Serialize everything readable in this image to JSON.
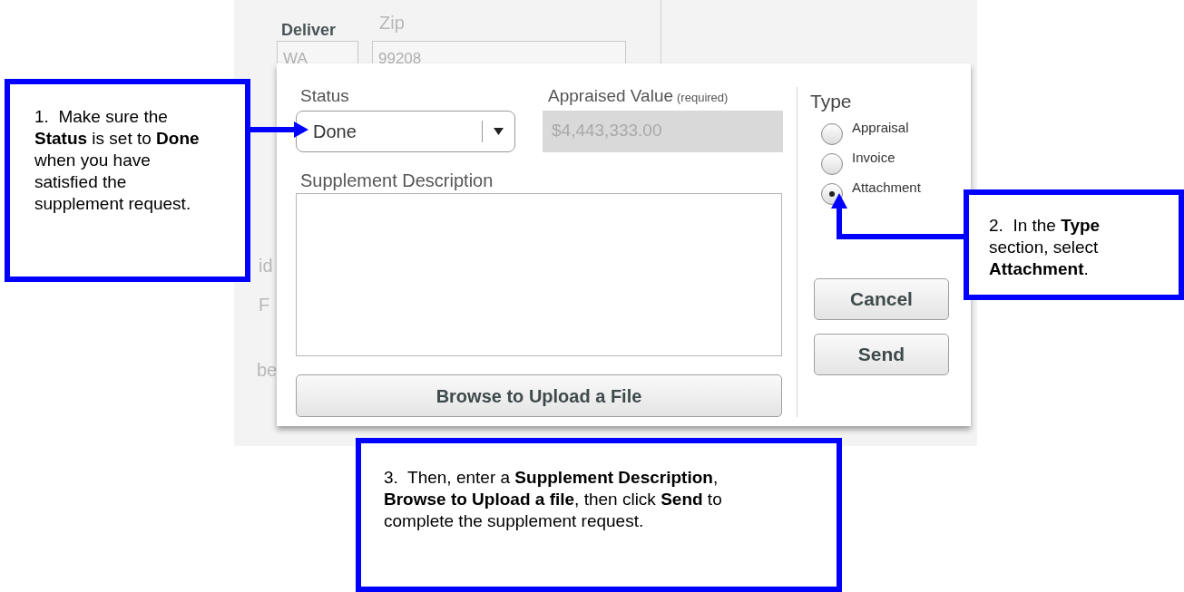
{
  "background": {
    "labels": [
      {
        "kind": "heading",
        "text": "Deliver"
      },
      {
        "kind": "faint",
        "text": "Zip"
      },
      {
        "kind": "field",
        "text": "WA"
      },
      {
        "kind": "field",
        "text": "99208"
      },
      {
        "kind": "faint",
        "text": "id"
      },
      {
        "kind": "faint",
        "text": "F"
      },
      {
        "kind": "faint",
        "text": "be"
      }
    ]
  },
  "dialog": {
    "status": {
      "label": "Status",
      "value": "Done"
    },
    "appraised_value": {
      "label": "Appraised Value",
      "note": "(required)",
      "value": "$4,443,333.00",
      "disabled": true
    },
    "description": {
      "label": "Supplement Description"
    },
    "browse_button": "Browse to Upload a File",
    "type": {
      "label": "Type",
      "options": [
        {
          "label": "Appraisal",
          "selected": false
        },
        {
          "label": "Invoice",
          "selected": false
        },
        {
          "label": "Attachment",
          "selected": true
        }
      ]
    },
    "buttons": [
      "Cancel",
      "Send"
    ]
  },
  "callouts": [
    {
      "text": "1.  Make sure the **Status** is set to **Done** when you have satisfied the supplement request."
    },
    {
      "text": "2.  In the **Type** section, select **Attachment**."
    },
    {
      "text": "3.  Then, enter a **Supplement Description**, **Browse to Upload a file**, then click **Send** to complete the supplement request."
    }
  ]
}
